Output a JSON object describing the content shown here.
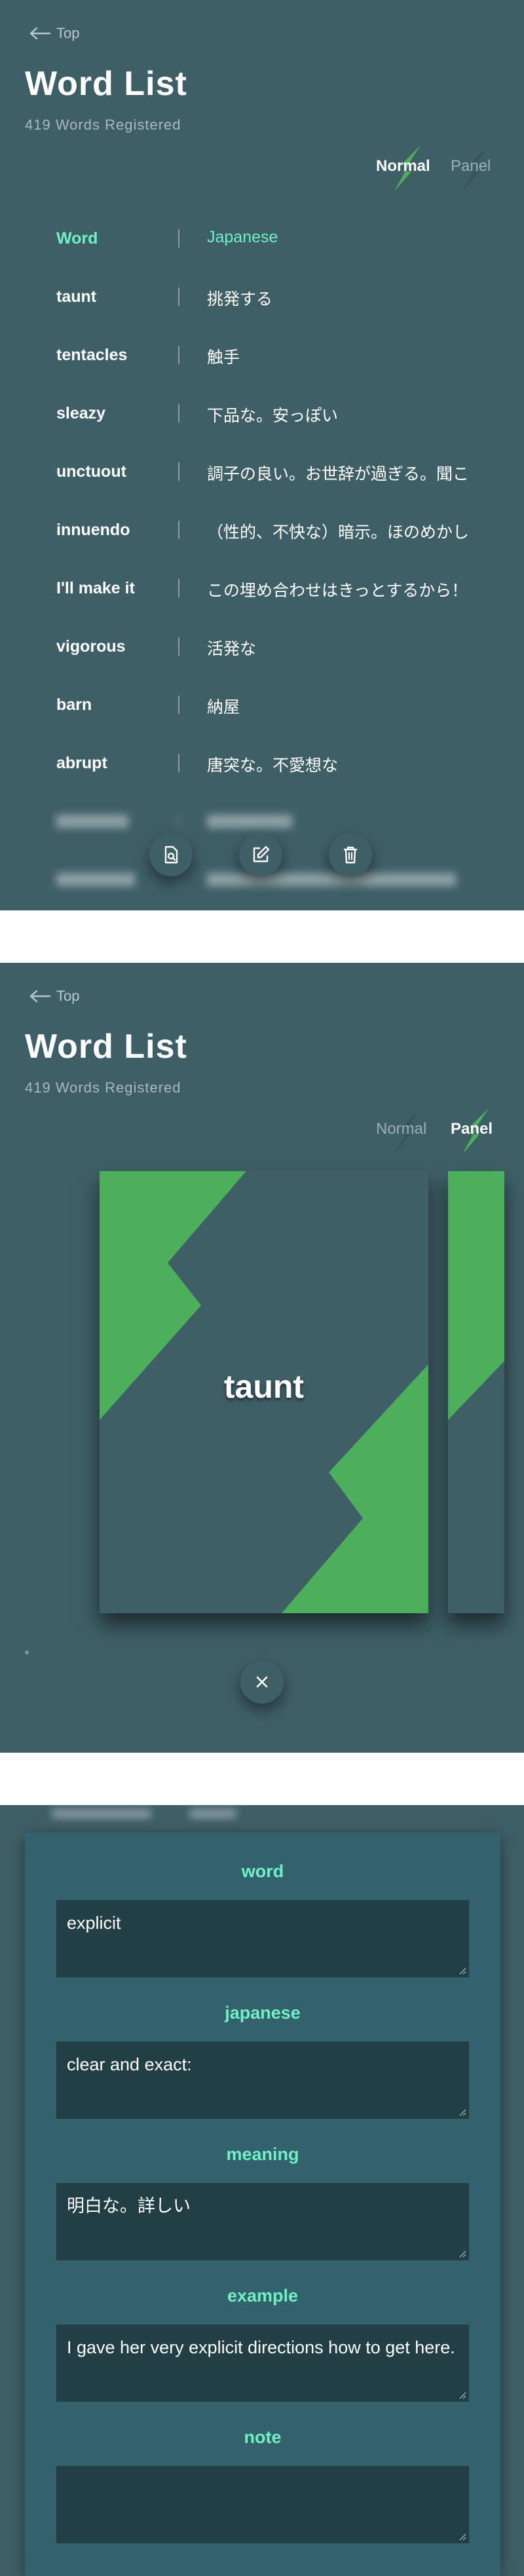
{
  "colors": {
    "background": "#3f5f67",
    "accent_text": "#6ff0c5",
    "accent_green": "#4caf5c",
    "field_bg": "#223f46"
  },
  "header": {
    "back_label": "Top",
    "title": "Word List",
    "count_text": "419 Words Registered",
    "toggle_normal": "Normal",
    "toggle_panel": "Panel"
  },
  "list": {
    "header": {
      "word": "Word",
      "japanese": "Japanese"
    },
    "rows": [
      {
        "word": "taunt",
        "japanese": "挑発する"
      },
      {
        "word": "tentacles",
        "japanese": "触手"
      },
      {
        "word": "sleazy",
        "japanese": "下品な。安っぽい"
      },
      {
        "word": "unctuout",
        "japanese": "調子の良い。お世辞が過ぎる。聞こ"
      },
      {
        "word": "innuendo",
        "japanese": "（性的、不快な）暗示。ほのめかし"
      },
      {
        "word": "I'll make it",
        "japanese": "この埋め合わせはきっとするから！"
      },
      {
        "word": "vigorous",
        "japanese": "活発な"
      },
      {
        "word": "barn",
        "japanese": "納屋"
      },
      {
        "word": "abrupt",
        "japanese": "唐突な。不愛想な"
      }
    ],
    "fab_icons": [
      "file-view-icon",
      "edit-icon",
      "trash-icon"
    ]
  },
  "panel_view": {
    "card_word": "taunt",
    "close_icon": "close-icon"
  },
  "form": {
    "fields": [
      {
        "label": "word",
        "value": "explicit"
      },
      {
        "label": "japanese",
        "value": "clear and exact:"
      },
      {
        "label": "meaning",
        "value": "明白な。詳しい"
      },
      {
        "label": "example",
        "value": "I gave her very explicit directions how to get here."
      },
      {
        "label": "note",
        "value": ""
      }
    ]
  }
}
